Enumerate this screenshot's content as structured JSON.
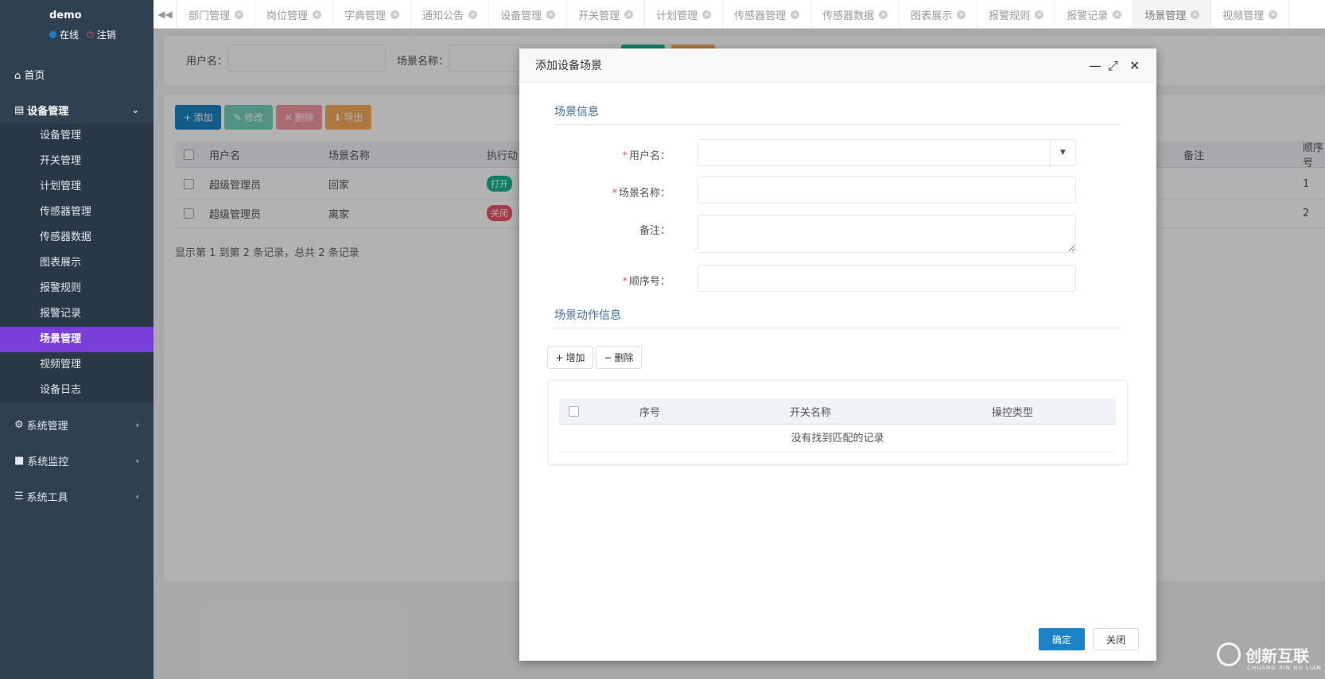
{
  "sidebar": {
    "username": "demo",
    "online_label": "在线",
    "logout_label": "注销",
    "home_label": "首页",
    "device_group_label": "设备管理",
    "device_items": [
      "设备管理",
      "开关管理",
      "计划管理",
      "传感器管理",
      "传感器数据",
      "图表展示",
      "报警规则",
      "报警记录",
      "场景管理",
      "视频管理",
      "设备日志"
    ],
    "active_item": "场景管理",
    "system_mgmt_label": "系统管理",
    "system_monitor_label": "系统监控",
    "system_tools_label": "系统工具"
  },
  "tabs": [
    "部门管理",
    "岗位管理",
    "字典管理",
    "通知公告",
    "设备管理",
    "开关管理",
    "计划管理",
    "传感器管理",
    "传感器数据",
    "图表展示",
    "报警规则",
    "报警记录",
    "场景管理",
    "视频管理"
  ],
  "active_tab": "场景管理",
  "search": {
    "username_label": "用户名：",
    "scene_name_label": "场景名称："
  },
  "toolbar": {
    "add_label": "添加",
    "edit_label": "修改",
    "delete_label": "删除",
    "export_label": "导出"
  },
  "grid": {
    "headers": {
      "username": "用户名",
      "scene_name": "场景名称",
      "action": "执行动",
      "remark": "备注",
      "order": "顺序号"
    },
    "rows": [
      {
        "username": "超级管理员",
        "scene_name": "回家",
        "action": "打开",
        "order": "1"
      },
      {
        "username": "超级管理员",
        "scene_name": "离家",
        "action": "关闭",
        "order": "2"
      }
    ],
    "footer": "显示第 1 到第 2 条记录，总共 2 条记录"
  },
  "modal": {
    "title": "添加设备场景",
    "section_scene": "场景信息",
    "label_username": "用户名：",
    "label_scene_name": "场景名称：",
    "label_remark": "备注：",
    "label_order": "顺序号：",
    "required_mark": "*",
    "section_action": "场景动作信息",
    "add_row_label": "增加",
    "delete_row_label": "删除",
    "inner_headers": {
      "seq": "序号",
      "switch_name": "开关名称",
      "control_type": "操控类型"
    },
    "empty_text": "没有找到匹配的记录",
    "ok_label": "确定",
    "close_label": "关闭"
  },
  "watermark": {
    "text": "创新互联",
    "sub": "CHUANG XIN HU LIAN"
  },
  "colors": {
    "sidebar": "#2f4050",
    "active": "#7a3fd8",
    "primary": "#1c84c6",
    "success": "#1ab394",
    "danger": "#ed5565",
    "warning": "#f8ac59",
    "online": "#1c84c6",
    "logout": "#ed5565"
  }
}
